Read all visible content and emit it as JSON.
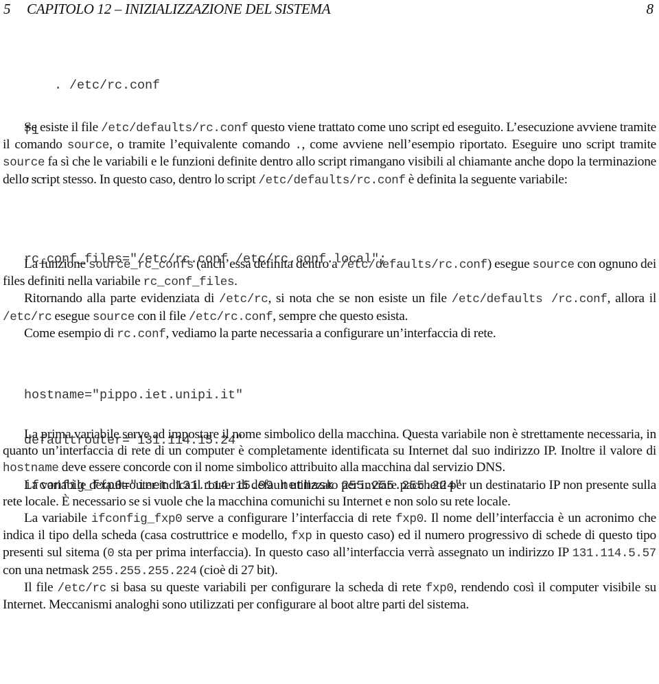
{
  "header": {
    "section_number": "5",
    "title": "CAPITOLO 12 – INIZIALIZZAZIONE DEL SISTEMA",
    "page_number": "8"
  },
  "code_block_1": [
    "    . /etc/rc.conf",
    "fi",
    "..."
  ],
  "paragraph_1": {
    "parts": [
      "Se esiste il file ",
      "/etc/defaults/rc.conf",
      " questo viene trattato come uno script ed eseguito. L’esecuzione avviene tramite il comando ",
      "source",
      ", o tramite l’equivalente comando ",
      ".",
      ", come avviene nell’esempio riportato. Eseguire uno script tramite ",
      "source",
      " fa sì che le variabili e le funzioni definite dentro allo script rimangano visibili al chiamante anche dopo la terminazione dello script stesso.  In questo caso, dentro lo script ",
      "/etc/defaults/rc.conf",
      " è definita la seguente variabile:"
    ]
  },
  "code_block_2": [
    "rc_conf_files=\"/etc/rc.conf /etc/rc.conf.local\";"
  ],
  "paragraph_2": {
    "parts": [
      "La funzione ",
      "source_rc_confs",
      " (anch’essa definita dentro a ",
      "/etc/defaults/rc.conf",
      ") esegue ",
      "source",
      " con ognuno dei files definiti nella variabile ",
      "rc_conf_files",
      "."
    ]
  },
  "paragraph_3": {
    "parts": [
      "Ritornando alla parte evidenziata di ",
      "/etc/rc",
      ", si nota che se non esiste un file ",
      "/etc/defaults /rc.conf",
      ", allora il ",
      "/etc/rc",
      " esegue ",
      "source",
      " con il file ",
      "/etc/rc.conf",
      ", sempre che questo esista."
    ]
  },
  "paragraph_4": {
    "parts": [
      "Come esempio di ",
      "rc.conf",
      ", vediamo la parte necessaria a configurare un’interfaccia di rete."
    ]
  },
  "code_block_3": [
    "hostname=\"pippo.iet.unipi.it\"",
    "defaultrouter=\"131.114.15.24\"",
    "ifconfig_fxp0=\"inet 131.114.15.99 netmask 255.255.255.224\""
  ],
  "paragraph_5": {
    "parts": [
      "La prima variabile serve ad impostare il nome simbolico della macchina.  Questa variabile non è strettamente necessaria, in quanto un’interfaccia di rete di un computer è completamente identificata su Internet dal suo indirizzo IP. Inoltre il valore di ",
      "hostname",
      " deve essere concorde con il nome simbolico attribuito alla macchina dal servizio DNS."
    ]
  },
  "paragraph_6": {
    "text": "La variabile defaultrouter indica il router di default utilizzato per inviare pacchetti per un destinatario IP non presente sulla rete locale.  È necessario se si vuole che la macchina comunichi su Internet e non solo su rete locale."
  },
  "paragraph_7": {
    "parts": [
      "La variabile ",
      "ifconfig_fxp0",
      " serve a configurare l’interfaccia di rete ",
      "fxp0",
      ". Il nome dell’interfaccia è un acronimo che indica il tipo della scheda (casa costruttrice e modello, ",
      "fxp",
      " in questo caso) ed il numero progressivo di schede di questo tipo presenti sul sitema (",
      "0",
      " sta per prima interfaccia).  In questo caso all’interfaccia verrà assegnato un indirizzo IP ",
      "131.114.5.57",
      " con una netmask ",
      "255.255.255.224",
      " (cioè di 27 bit)."
    ]
  },
  "paragraph_8": {
    "parts": [
      "Il file ",
      "/etc/rc",
      " si basa su queste variabili per configurare la scheda di rete ",
      "fxp0",
      ", rendendo così il computer visibile su Internet. Meccanismi analoghi sono utilizzati per configurare al boot altre parti del sistema."
    ]
  }
}
